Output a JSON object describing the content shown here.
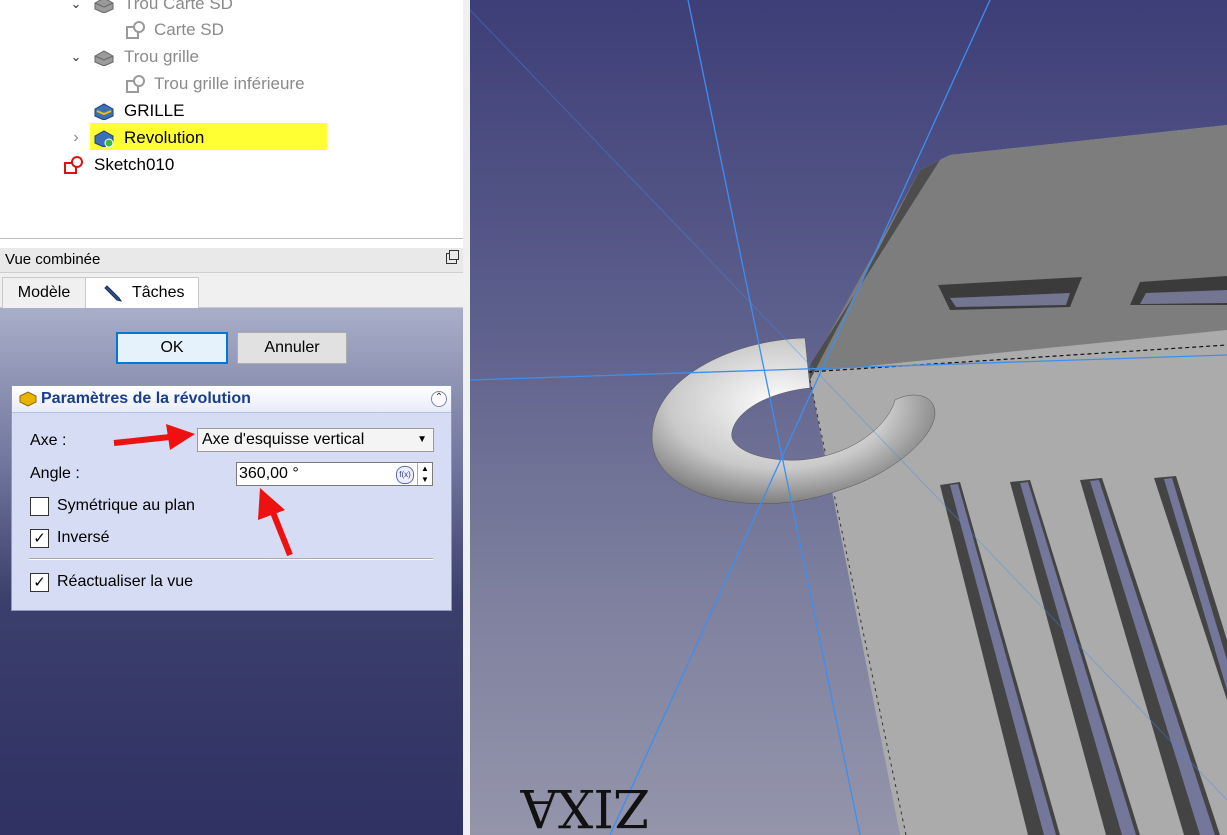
{
  "tree": {
    "items": [
      {
        "label": "Trou Carte SD",
        "state": "grey"
      },
      {
        "label": "Carte SD",
        "state": "grey"
      },
      {
        "label": "Trou grille",
        "state": "grey"
      },
      {
        "label": "Trou grille inférieure",
        "state": "grey"
      },
      {
        "label": "GRILLE",
        "state": "normal"
      },
      {
        "label": "Revolution",
        "state": "selected"
      },
      {
        "label": "Sketch010",
        "state": "normal"
      }
    ]
  },
  "combo": {
    "title": "Vue combinée",
    "tabs": [
      {
        "label": "Modèle"
      },
      {
        "label": "Tâches"
      }
    ]
  },
  "task": {
    "ok_label": "OK",
    "cancel_label": "Annuler",
    "panel_title": "Paramètres de la révolution",
    "axis_label": "Axe :",
    "axis_value": "Axe d'esquisse vertical",
    "angle_label": "Angle :",
    "angle_value": "360,00 °",
    "fx_label": "f(x)",
    "symmetric_label": "Symétrique au plan",
    "symmetric_checked": false,
    "reversed_label": "Inversé",
    "reversed_checked": true,
    "refresh_label": "Réactualiser la vue",
    "refresh_checked": true
  },
  "viewport": {
    "engraved_text": "ZIXA"
  },
  "colors": {
    "selection_highlight": "#ffff33",
    "axis_line": "#3d8ef0",
    "annotation_arrow": "#ee1111",
    "ok_focus": "#0078d7",
    "panel_title": "#1a3e8c"
  },
  "icons": {
    "tree_chevron_open": "chevron-down-icon",
    "tree_chevron_closed": "chevron-right-icon",
    "pocket": "pocket-icon",
    "sketch": "sketch-icon",
    "body": "body-icon",
    "revolution": "revolution-icon",
    "tasks": "pencil-icon"
  }
}
